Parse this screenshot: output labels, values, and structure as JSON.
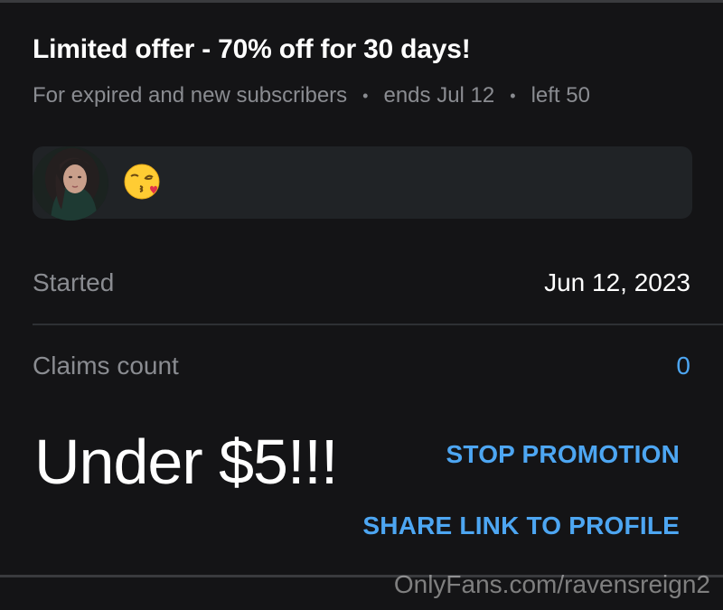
{
  "promotion": {
    "title": "Limited offer - 70% off for 30 days!",
    "audience": "For expired and new subscribers",
    "ends": "ends Jul 12",
    "remaining": "left 50",
    "separator": "•",
    "message_emoji": "😘",
    "emoji_icon": "kissing-face-icon"
  },
  "details": {
    "started_label": "Started",
    "started_value": "Jun 12, 2023",
    "claims_label": "Claims count",
    "claims_value": "0"
  },
  "overlay_text": "Under $5!!!",
  "actions": {
    "stop_label": "STOP PROMOTION",
    "share_label": "SHARE LINK TO PROFILE"
  },
  "watermark": "OnlyFans.com/ravensreign2",
  "colors": {
    "background": "#141416",
    "card": "#202326",
    "accent": "#4da6f2",
    "muted_text": "#8a8c91"
  }
}
